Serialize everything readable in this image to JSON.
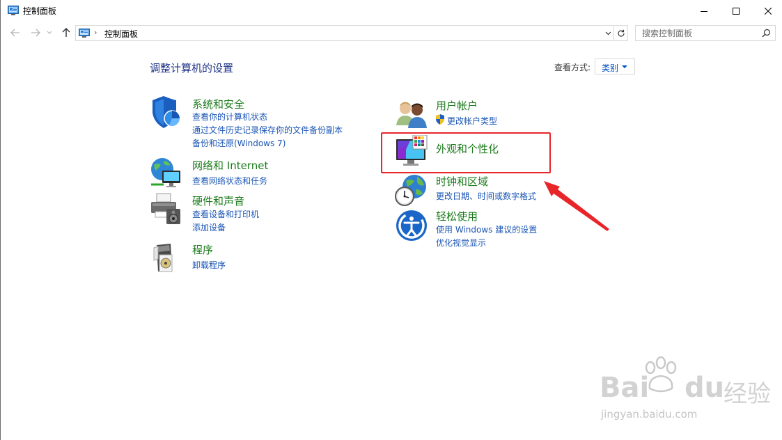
{
  "window": {
    "title": "控制面板",
    "colors": {
      "link": "#1a55b5",
      "category": "#1a7a1a",
      "heading": "#1e3287",
      "annotation": "#e8262a"
    }
  },
  "nav": {
    "address_text": "控制面板",
    "search_placeholder": "搜索控制面板"
  },
  "content": {
    "heading": "调整计算机的设置",
    "view_by_label": "查看方式:",
    "view_by_value": "类别"
  },
  "categories": [
    {
      "title": "系统和安全",
      "icon": "shield-icon",
      "links": [
        "查看你的计算机状态",
        "通过文件历史记录保存你的文件备份副本",
        "备份和还原(Windows 7)"
      ]
    },
    {
      "title": "网络和 Internet",
      "icon": "network-icon",
      "links": [
        "查看网络状态和任务"
      ]
    },
    {
      "title": "硬件和声音",
      "icon": "printer-icon",
      "links": [
        "查看设备和打印机",
        "添加设备"
      ]
    },
    {
      "title": "程序",
      "icon": "programs-icon",
      "links": [
        "卸载程序"
      ]
    },
    {
      "title": "用户帐户",
      "icon": "users-icon",
      "links": [
        "更改帐户类型"
      ]
    },
    {
      "title": "外观和个性化",
      "icon": "monitor-icon",
      "links": []
    },
    {
      "title": "时钟和区域",
      "icon": "clock-globe-icon",
      "links": [
        "更改日期、时间或数字格式"
      ]
    },
    {
      "title": "轻松使用",
      "icon": "ease-of-access-icon",
      "links": [
        "使用 Windows 建议的设置",
        "优化视觉显示"
      ]
    }
  ],
  "watermark": {
    "brand_left": "Bai",
    "brand_right": "du",
    "brand_cn": "经验",
    "url": "jingyan.baidu.com"
  }
}
